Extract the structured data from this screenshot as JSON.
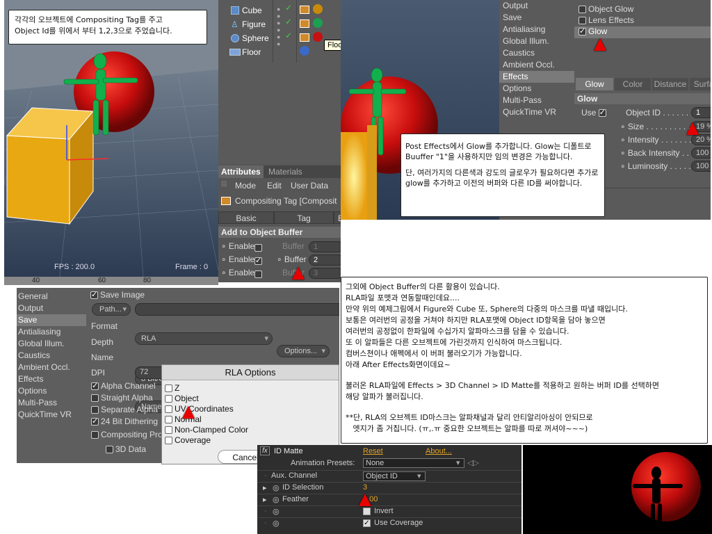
{
  "viewport": {
    "fps": "FPS : 200.0",
    "frame": "Frame : 0",
    "ruler": [
      "40",
      "60",
      "80"
    ]
  },
  "note1": {
    "line1": "각각의 오브젝트에 Compositing Tag를 주고",
    "line2": "Object Id를 위에서 부터 1,2,3으로 주었습니다."
  },
  "objects": [
    {
      "name": "Cube",
      "icon": "cube-icon"
    },
    {
      "name": "Figure",
      "icon": "figure-icon"
    },
    {
      "name": "Sphere",
      "icon": "sphere-icon"
    },
    {
      "name": "Floor",
      "icon": "floor-icon"
    }
  ],
  "tooltip": "Floo",
  "attributes": {
    "tabs": [
      "Attributes",
      "Materials"
    ],
    "menu": [
      "Mode",
      "Edit",
      "User Data"
    ],
    "title": "Compositing Tag [Composit",
    "subtabs": [
      "Basic",
      "Tag",
      "E"
    ],
    "section": "Add to Object Buffer",
    "rows": [
      {
        "enable": "Enable",
        "checked": false,
        "buffer": "Buffer",
        "value": "1"
      },
      {
        "enable": "Enable",
        "checked": true,
        "buffer": "Buffer",
        "value": "2"
      },
      {
        "enable": "Enable",
        "checked": false,
        "buffer": "Buffer",
        "value": "3"
      }
    ]
  },
  "render_settings_top": {
    "menu": [
      "Output",
      "Save",
      "Antialiasing",
      "Global Illum.",
      "Caustics",
      "Ambient Occl.",
      "Effects",
      "Options",
      "Multi-Pass",
      "QuickTime VR"
    ],
    "selected": "Effects",
    "effects": [
      {
        "label": "Object Glow",
        "checked": false
      },
      {
        "label": "Lens Effects",
        "checked": false
      },
      {
        "label": "Glow",
        "checked": true
      }
    ],
    "tabs": [
      "Glow",
      "Color",
      "Distance",
      "Surfa"
    ],
    "section": "Glow",
    "use_label": "Use",
    "object_id_label": "Object ID . . . . . .",
    "object_id_value": "1",
    "params": [
      {
        "label": "Size . . . . . . . . . . .",
        "value": "19 %"
      },
      {
        "label": "Intensity . . . . . . . .",
        "value": "20 %"
      },
      {
        "label": "Back Intensity . .",
        "value": "100"
      },
      {
        "label": "Luminosity . . . . .",
        "value": "100"
      }
    ]
  },
  "note2": {
    "p1": "Post Effects에서 Glow를 추가합니다. Glow는 디폴트로 Buuffer \"1\"을 사용하지만 임의 변경은 가능합니다.",
    "p2": "단, 여러가지의 다른색과 강도의 글로우가 필요하다면 추가로 glow를 추가하고 이전의 버퍼와 다른 ID를 써야합니다."
  },
  "save_panel": {
    "menu": [
      "General",
      "Output",
      "Save",
      "Antialiasing",
      "Global Illum.",
      "Caustics",
      "Ambient Occl.",
      "Effects",
      "Options",
      "Multi-Pass",
      "QuickTime VR"
    ],
    "selected": "Save",
    "save_image": "Save Image",
    "path_btn": "Path...",
    "format_label": "Format",
    "format_value": "RLA",
    "options_btn": "Options...",
    "depth_label": "Depth",
    "depth_value": "8 Bit/Channel",
    "name_label": "Name",
    "name_value": "Name0000.TIF",
    "dpi_label": "DPI",
    "dpi_value": "72",
    "checks": [
      {
        "label": "Alpha Channel",
        "checked": true
      },
      {
        "label": "Straight Alpha",
        "checked": false
      },
      {
        "label": "Separate Alpha",
        "checked": false
      },
      {
        "label": "24 Bit Dithering",
        "checked": true
      },
      {
        "label": "Compositing Pro",
        "checked": false
      }
    ],
    "data3d": "3D Data"
  },
  "rla": {
    "title": "RLA Options",
    "items": [
      {
        "label": "Z",
        "checked": true
      },
      {
        "label": "Object",
        "checked": true
      },
      {
        "label": "UV Coordinates",
        "checked": false
      },
      {
        "label": "Normal",
        "checked": false
      },
      {
        "label": "Non-Clamped Color",
        "checked": true
      },
      {
        "label": "Coverage",
        "checked": true
      }
    ],
    "cancel": "Cancel"
  },
  "note3": {
    "lines": [
      "그외에 Object Buffer의 다른 활용이 있습니다.",
      "RLA파일 포맷과 연동할때인데요....",
      "만약 위의 예제그림에서 Figure와 Cube 또, Sphere의 다중의 마스크를 따낼 때입니다.",
      "보통은 여러번의 공정을 거쳐야 하지만 RLA포맷에 Object ID항목을 담아 놓으면",
      "여러번의 공정없이 한파일에 수십가지 알파마스크를 담을 수 있습니다.",
      "또 이 알파들은 다른 오브젝트에 가린것까지 인식하여 마스크됩니다.",
      "컴버스쳔이나 애펙에서 이 버퍼 불러오기가 가능합니다.",
      "아래 After Effects화면이데요~",
      "",
      "불러온 RLA파일에 Effects > 3D Channel > ID Matte를 적용하고 원하는 버퍼 ID를 선택하면",
      "해당 알파가 불러집니다.",
      "",
      "**단, RLA의 오브젝트 ID마스크는 알파채널과 달리 안티알리아싱이 안되므로",
      "   엣지가 좀 거칩니다. (ㅠ,.ㅠ 중요한 오브젝트는 알파를 따로 꺼셔야~~~)"
    ]
  },
  "ae": {
    "fx": "fx",
    "effect": "ID Matte",
    "reset": "Reset",
    "about": "About...",
    "presets_label": "Animation Presets:",
    "presets_value": "None",
    "aux_label": "Aux. Channel",
    "aux_value": "Object ID",
    "id_label": "ID Selection",
    "id_value": "3",
    "feather_label": "Feather",
    "feather_value": "0.00",
    "invert": "Invert",
    "use_coverage": "Use Coverage"
  }
}
